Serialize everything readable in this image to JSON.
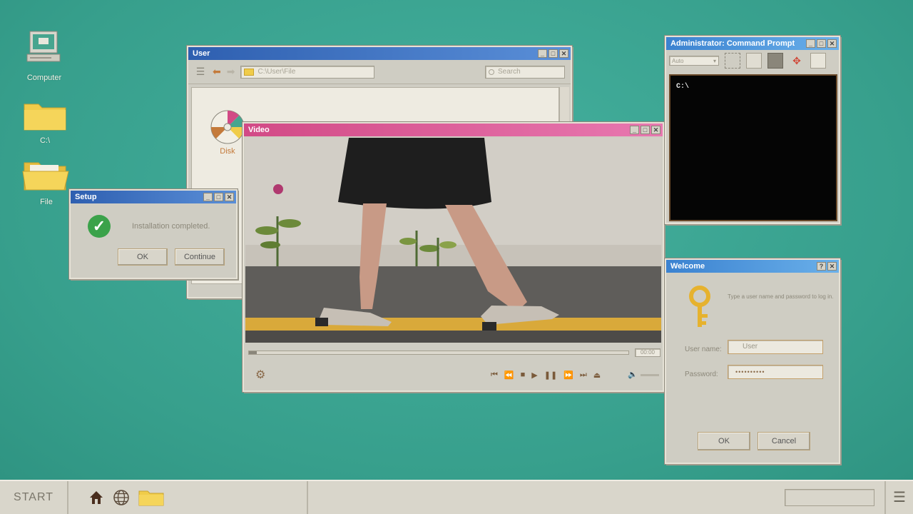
{
  "desktop": {
    "icons": [
      {
        "label": "Computer"
      },
      {
        "label": "C:\\"
      },
      {
        "label": "File"
      }
    ]
  },
  "explorer": {
    "title": "User",
    "path": "C:\\User\\File",
    "search_placeholder": "Search",
    "items": [
      {
        "label": "Disk"
      }
    ]
  },
  "setup": {
    "title": "Setup",
    "message": "Installation completed.",
    "ok_label": "OK",
    "continue_label": "Continue"
  },
  "video": {
    "title": "Video",
    "time": "00:00",
    "progress": 0.02
  },
  "cmd": {
    "title": "Administrator: Command Prompt",
    "font_select": "Auto",
    "prompt": "C:\\"
  },
  "welcome": {
    "title": "Welcome",
    "help_label": "?",
    "instructions": "Type a user name and password to log in.",
    "username_label": "User name:",
    "username_value": "User",
    "password_label": "Password:",
    "password_value": "••••••••••",
    "ok_label": "OK",
    "cancel_label": "Cancel"
  },
  "taskbar": {
    "start_label": "START"
  },
  "colors": {
    "desktop": "#3aaa96",
    "title_blue": "#2e5fb0",
    "title_pink": "#d24a86",
    "folder": "#f0cc4a"
  }
}
